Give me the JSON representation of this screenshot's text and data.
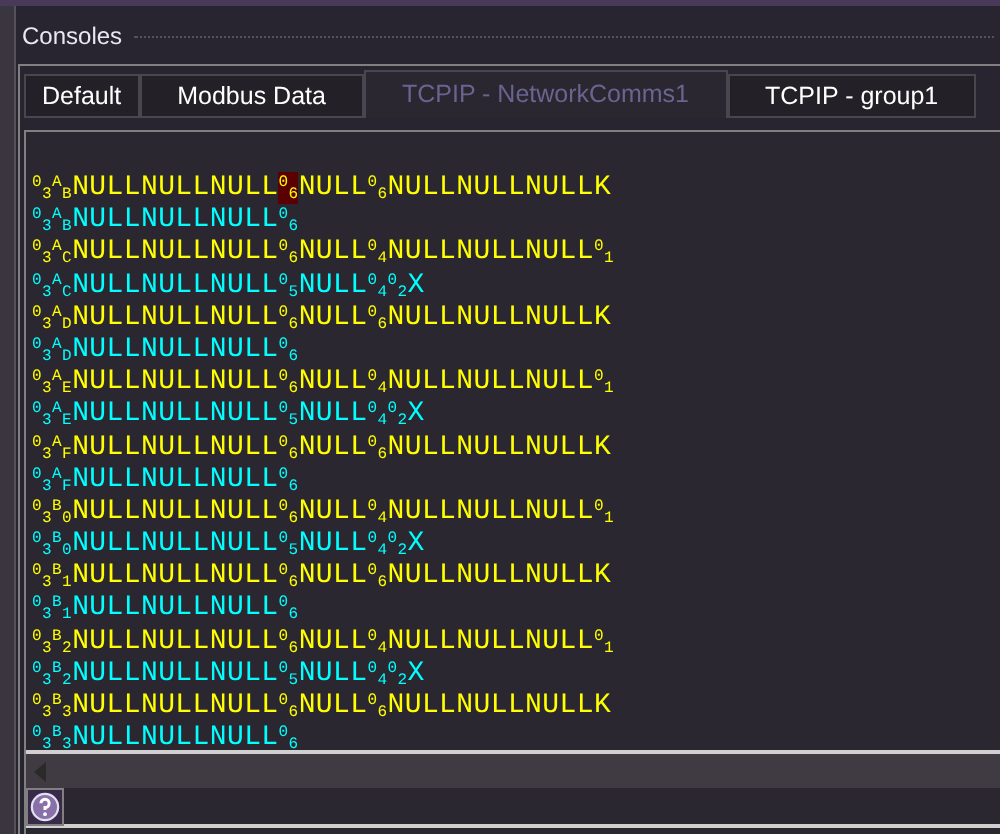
{
  "panel": {
    "title": "Consoles"
  },
  "tabs": [
    {
      "label": "Default",
      "selected": false
    },
    {
      "label": "Modbus Data",
      "selected": false
    },
    {
      "label": "TCPIP - NetworkComms1",
      "selected": true
    },
    {
      "label": "TCPIP - group1",
      "selected": false
    }
  ],
  "console_lines": [
    {
      "color": "#ffff00",
      "segments": [
        {
          "text": "$^{0}$$_{3}$$^{A}$$_{B}$NULLNULLNULL",
          "highlighted": false
        },
        {
          "text": "$^{0}$$_{6}$",
          "highlighted": true
        },
        {
          "text": "NULL$^{0}$$_{6}$NULLNULLNULLK",
          "highlighted": false
        }
      ]
    },
    {
      "color": "#00ffff",
      "segments": [
        {
          "text": "$^{0}$$_{3}$$^{A}$$_{B}$NULLNULLNULL$^{0}$$_{6}$",
          "highlighted": false
        }
      ]
    },
    {
      "color": "#ffff00",
      "segments": [
        {
          "text": "$^{0}$$_{3}$$^{A}$$_{C}$NULLNULLNULL$^{0}$$_{6}$NULL$^{0}$$_{4}$NULLNULLNULL$^{0}$$_{1}$",
          "highlighted": false
        }
      ]
    },
    {
      "color": "#00ffff",
      "segments": [
        {
          "text": "$^{0}$$_{3}$$^{A}$$_{C}$NULLNULLNULL$^{0}$$_{5}$NULL$^{0}$$_{4}$$^{0}$$_{2}$X",
          "highlighted": false
        }
      ]
    },
    {
      "color": "#ffff00",
      "segments": [
        {
          "text": "$^{0}$$_{3}$$^{A}$$_{D}$NULLNULLNULL$^{0}$$_{6}$NULL$^{0}$$_{6}$NULLNULLNULLK",
          "highlighted": false
        }
      ]
    },
    {
      "color": "#00ffff",
      "segments": [
        {
          "text": "$^{0}$$_{3}$$^{A}$$_{D}$NULLNULLNULL$^{0}$$_{6}$",
          "highlighted": false
        }
      ]
    },
    {
      "color": "#ffff00",
      "segments": [
        {
          "text": "$^{0}$$_{3}$$^{A}$$_{E}$NULLNULLNULL$^{0}$$_{6}$NULL$^{0}$$_{4}$NULLNULLNULL$^{0}$$_{1}$",
          "highlighted": false
        }
      ]
    },
    {
      "color": "#00ffff",
      "segments": [
        {
          "text": "$^{0}$$_{3}$$^{A}$$_{E}$NULLNULLNULL$^{0}$$_{5}$NULL$^{0}$$_{4}$$^{0}$$_{2}$X",
          "highlighted": false
        }
      ]
    },
    {
      "color": "#ffff00",
      "segments": [
        {
          "text": "$^{0}$$_{3}$$^{A}$$_{F}$NULLNULLNULL$^{0}$$_{6}$NULL$^{0}$$_{6}$NULLNULLNULLK",
          "highlighted": false
        }
      ]
    },
    {
      "color": "#00ffff",
      "segments": [
        {
          "text": "$^{0}$$_{3}$$^{A}$$_{F}$NULLNULLNULL$^{0}$$_{6}$",
          "highlighted": false
        }
      ]
    },
    {
      "color": "#ffff00",
      "segments": [
        {
          "text": "$^{0}$$_{3}$$^{B}$$_{0}$NULLNULLNULL$^{0}$$_{6}$NULL$^{0}$$_{4}$NULLNULLNULL$^{0}$$_{1}$",
          "highlighted": false
        }
      ]
    },
    {
      "color": "#00ffff",
      "segments": [
        {
          "text": "$^{0}$$_{3}$$^{B}$$_{0}$NULLNULLNULL$^{0}$$_{5}$NULL$^{0}$$_{4}$$^{0}$$_{2}$X",
          "highlighted": false
        }
      ]
    },
    {
      "color": "#ffff00",
      "segments": [
        {
          "text": "$^{0}$$_{3}$$^{B}$$_{1}$NULLNULLNULL$^{0}$$_{6}$NULL$^{0}$$_{6}$NULLNULLNULLK",
          "highlighted": false
        }
      ]
    },
    {
      "color": "#00ffff",
      "segments": [
        {
          "text": "$^{0}$$_{3}$$^{B}$$_{1}$NULLNULLNULL$^{0}$$_{6}$",
          "highlighted": false
        }
      ]
    },
    {
      "color": "#ffff00",
      "segments": [
        {
          "text": "$^{0}$$_{3}$$^{B}$$_{2}$NULLNULLNULL$^{0}$$_{6}$NULL$^{0}$$_{4}$NULLNULLNULL$^{0}$$_{1}$",
          "highlighted": false
        }
      ]
    },
    {
      "color": "#00ffff",
      "segments": [
        {
          "text": "$^{0}$$_{3}$$^{B}$$_{2}$NULLNULLNULL$^{0}$$_{5}$NULL$^{0}$$_{4}$$^{0}$$_{2}$X",
          "highlighted": false
        }
      ]
    },
    {
      "color": "#ffff00",
      "segments": [
        {
          "text": "$^{0}$$_{3}$$^{B}$$_{3}$NULLNULLNULL$^{0}$$_{6}$NULL$^{0}$$_{6}$NULLNULLNULLK",
          "highlighted": false
        }
      ]
    },
    {
      "color": "#00ffff",
      "segments": [
        {
          "text": "$^{0}$$_{3}$$^{B}$$_{3}$NULLNULLNULL$^{0}$$_{6}$",
          "highlighted": false
        }
      ]
    }
  ]
}
